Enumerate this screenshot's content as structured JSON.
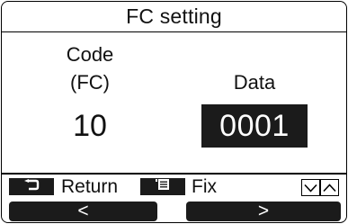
{
  "screen": {
    "title": "FC setting",
    "code": {
      "label_line1": "Code",
      "label_line2": "(FC)",
      "value": "10"
    },
    "data": {
      "label": "Data",
      "value": "0001"
    }
  },
  "legend": {
    "return_label": "Return",
    "return_icon": "return-arrow-icon",
    "fix_label": "Fix",
    "fix_icon": "menu-list-icon",
    "down_icon": "chevron-down-icon",
    "up_icon": "chevron-up-icon"
  },
  "softkeys": {
    "left_label": "<",
    "right_label": ">"
  },
  "colors": {
    "background": "#ffffff",
    "inverse": "#1b1b1b",
    "text": "#111111"
  }
}
